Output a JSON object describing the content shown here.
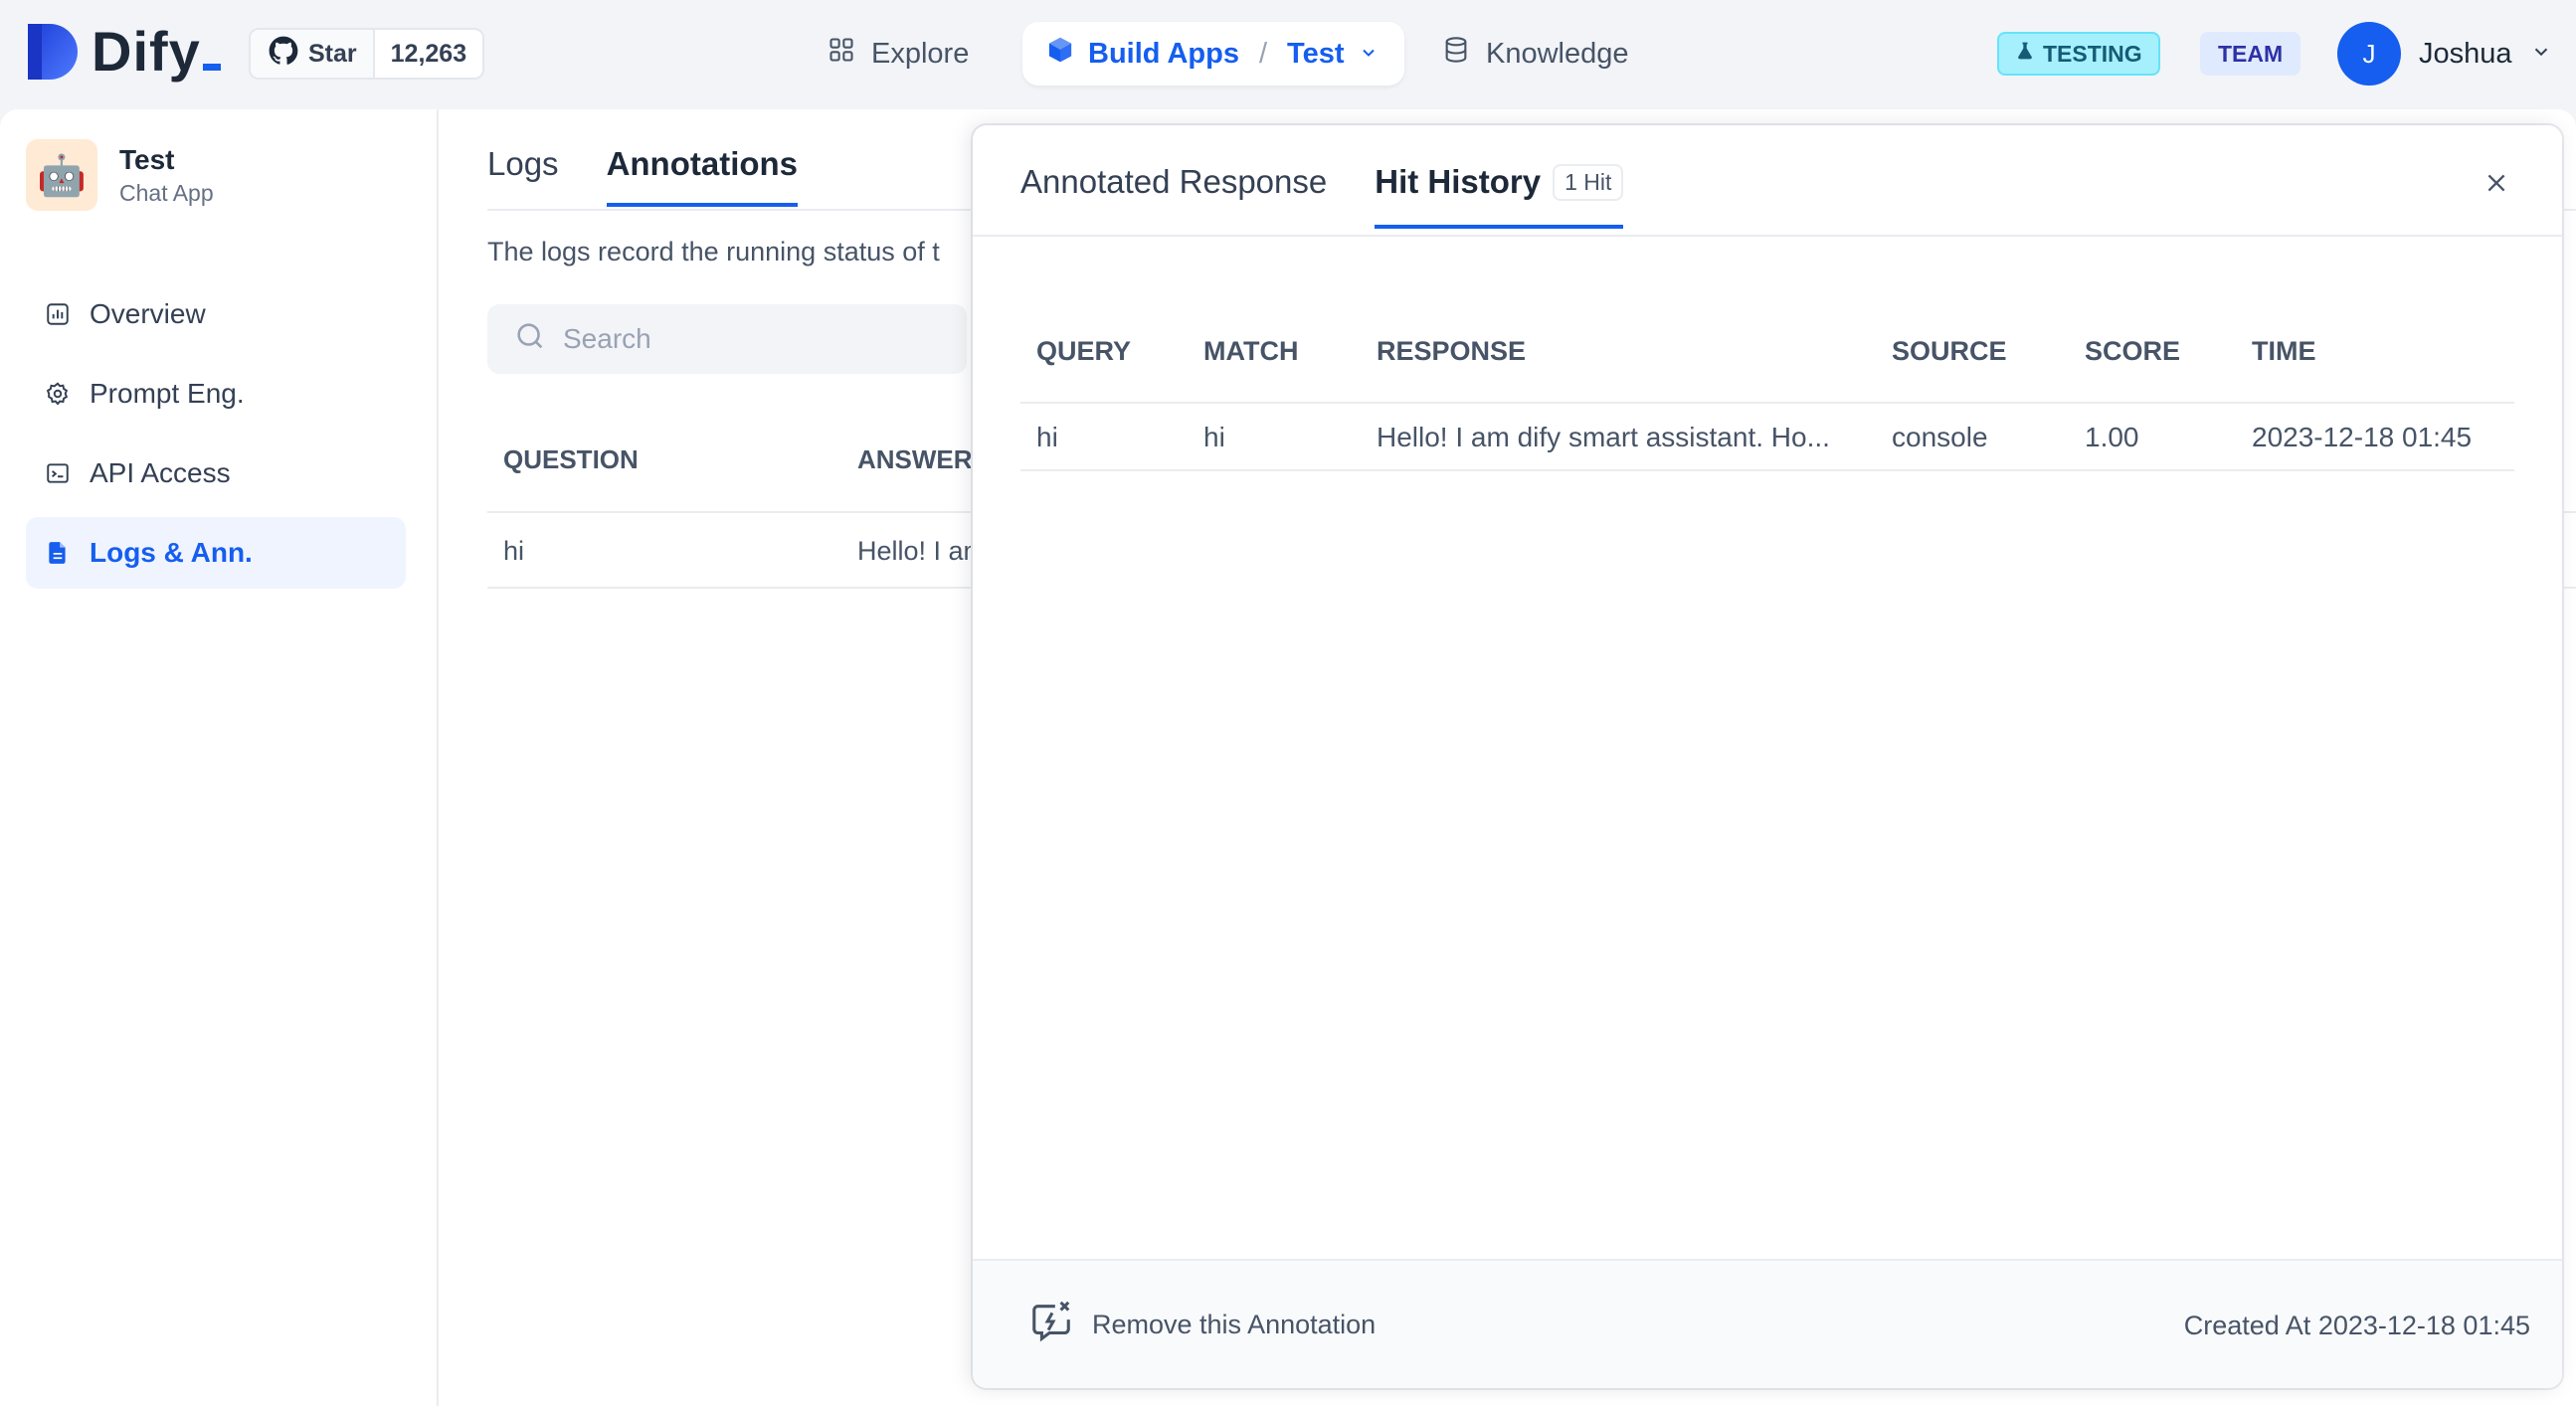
{
  "header": {
    "logo_text": "Dify",
    "github": {
      "star_label": "Star",
      "count": "12,263"
    },
    "nav": {
      "explore": "Explore",
      "build_apps": "Build Apps",
      "separator": "/",
      "current_app": "Test",
      "knowledge": "Knowledge"
    },
    "env_badge": "TESTING",
    "team_badge": "TEAM",
    "user": {
      "initial": "J",
      "name": "Joshua"
    }
  },
  "sidebar": {
    "app": {
      "name": "Test",
      "type": "Chat App"
    },
    "items": [
      {
        "label": "Overview",
        "icon": "chart-icon",
        "active": false
      },
      {
        "label": "Prompt Eng.",
        "icon": "gear-icon",
        "active": false
      },
      {
        "label": "API Access",
        "icon": "terminal-icon",
        "active": false
      },
      {
        "label": "Logs & Ann.",
        "icon": "document-icon",
        "active": true
      }
    ]
  },
  "main": {
    "tabs": [
      {
        "label": "Logs",
        "active": false
      },
      {
        "label": "Annotations",
        "active": true
      }
    ],
    "description": "The logs record the running status of t",
    "search": {
      "placeholder": "Search",
      "value": ""
    },
    "table": {
      "columns": [
        "QUESTION",
        "ANSWER"
      ],
      "rows": [
        {
          "question": "hi",
          "answer": "Hello! I am"
        }
      ]
    }
  },
  "drawer": {
    "tabs": [
      {
        "label": "Annotated Response",
        "active": false
      },
      {
        "label": "Hit History",
        "active": true,
        "badge": "1 Hit"
      }
    ],
    "columns": [
      "QUERY",
      "MATCH",
      "RESPONSE",
      "SOURCE",
      "SCORE",
      "TIME"
    ],
    "rows": [
      {
        "query": "hi",
        "match": "hi",
        "response": "Hello! I am dify smart assistant. Ho...",
        "source": "console",
        "score": "1.00",
        "time": "2023-12-18 01:45"
      }
    ],
    "footer": {
      "remove_label": "Remove this Annotation",
      "created_at": "Created At 2023-12-18 01:45"
    }
  },
  "colors": {
    "accent": "#155eef",
    "testing_bg": "#a5f0fc",
    "team_bg": "#e0eaff",
    "active_menu_bg": "#eff4ff"
  }
}
